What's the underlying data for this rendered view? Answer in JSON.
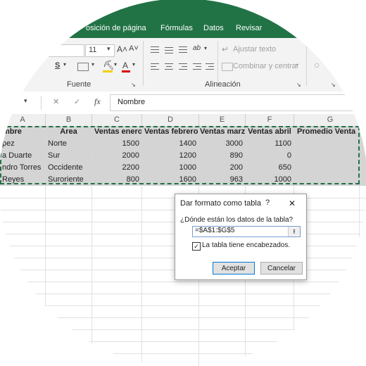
{
  "ribbon": {
    "tabs": [
      "osición de página",
      "Fórmulas",
      "Datos",
      "Revisar"
    ],
    "font_size": "11",
    "grow_font": "A˄",
    "shrink_font": "A˅",
    "wrap_text": "Ajustar texto",
    "merge_center": "Combinar y centrar",
    "group_font": "Fuente",
    "group_alignment": "Alineación",
    "underline_glyph": "S",
    "font_color_glyph": "A",
    "orientation_glyph": "ab"
  },
  "formula_bar": {
    "fx": "fx",
    "value": "Nombre",
    "cancel_glyph": "✕",
    "enter_glyph": "✓"
  },
  "columns": [
    "A",
    "B",
    "C",
    "D",
    "E",
    "F",
    "G"
  ],
  "table": {
    "headers": [
      "mbre",
      "Area",
      "Ventas enero",
      "Ventas febrero",
      "Ventas marzo",
      "Ventas abril",
      "Promedio Venta"
    ],
    "rows": [
      [
        "pez",
        "Norte",
        "1500",
        "1400",
        "3000",
        "1100",
        ""
      ],
      [
        "a Duarte",
        "Sur",
        "2000",
        "1200",
        "890",
        "0",
        ""
      ],
      [
        "ndro Torres",
        "Occidente",
        "2200",
        "1000",
        "200",
        "650",
        ""
      ],
      [
        "Reyes",
        "Suroriente",
        "800",
        "1600",
        "963",
        "1000",
        ""
      ]
    ]
  },
  "dialog": {
    "title": "Dar formato como tabla",
    "help": "?",
    "close": "✕",
    "question": "¿Dónde están los datos de la tabla?",
    "range": "=$A$1:$G$5",
    "checkbox_label": "La tabla tiene encabezados.",
    "checkbox_checked": true,
    "ok": "Aceptar",
    "cancel": "Cancelar"
  },
  "colors": {
    "excel_green": "#217346",
    "selection_grey": "#d4d4d4"
  }
}
